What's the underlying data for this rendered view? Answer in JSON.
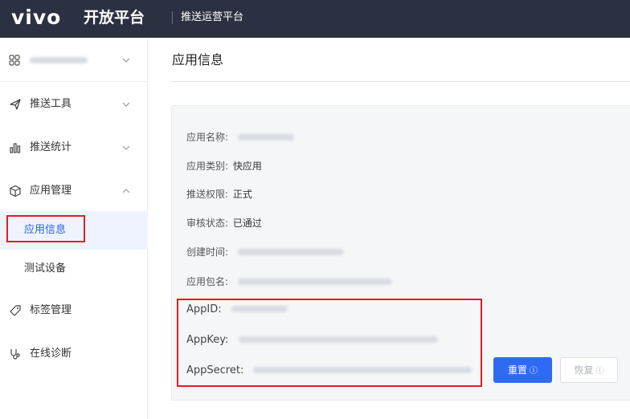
{
  "header": {
    "logo": "vivo",
    "platform": "开放平台",
    "subtitle": "推送运营平台",
    "background": "#2b3140"
  },
  "sidebar": {
    "app_selector": {
      "icon": "grid-icon"
    },
    "items": [
      {
        "label": "推送工具",
        "icon": "send-icon"
      },
      {
        "label": "推送统计",
        "icon": "bar-chart-icon"
      },
      {
        "label": "应用管理",
        "icon": "cube-icon",
        "expanded": true
      },
      {
        "label": "标签管理",
        "icon": "tag-icon"
      },
      {
        "label": "在线诊断",
        "icon": "stethoscope-icon"
      }
    ],
    "sub_items": [
      {
        "label": "应用信息",
        "active": true
      },
      {
        "label": "测试设备"
      }
    ]
  },
  "main": {
    "title": "应用信息",
    "fields": [
      {
        "label": "应用名称:",
        "value": ""
      },
      {
        "label": "应用类别:",
        "value": "快应用"
      },
      {
        "label": "推送权限:",
        "value": "正式"
      },
      {
        "label": "审核状态:",
        "value": "已通过"
      },
      {
        "label": "创建时间:",
        "value": ""
      },
      {
        "label": "应用包名:",
        "value": ""
      },
      {
        "label": "AppID:",
        "value": ""
      },
      {
        "label": "AppKey:",
        "value": ""
      },
      {
        "label": "AppSecret:",
        "value": ""
      }
    ],
    "buttons": {
      "reset": "重置",
      "restore": "恢复"
    }
  },
  "colors": {
    "accent": "#2f6bf2",
    "highlight_box": "#e11d24",
    "active_text": "#2b62e3"
  }
}
